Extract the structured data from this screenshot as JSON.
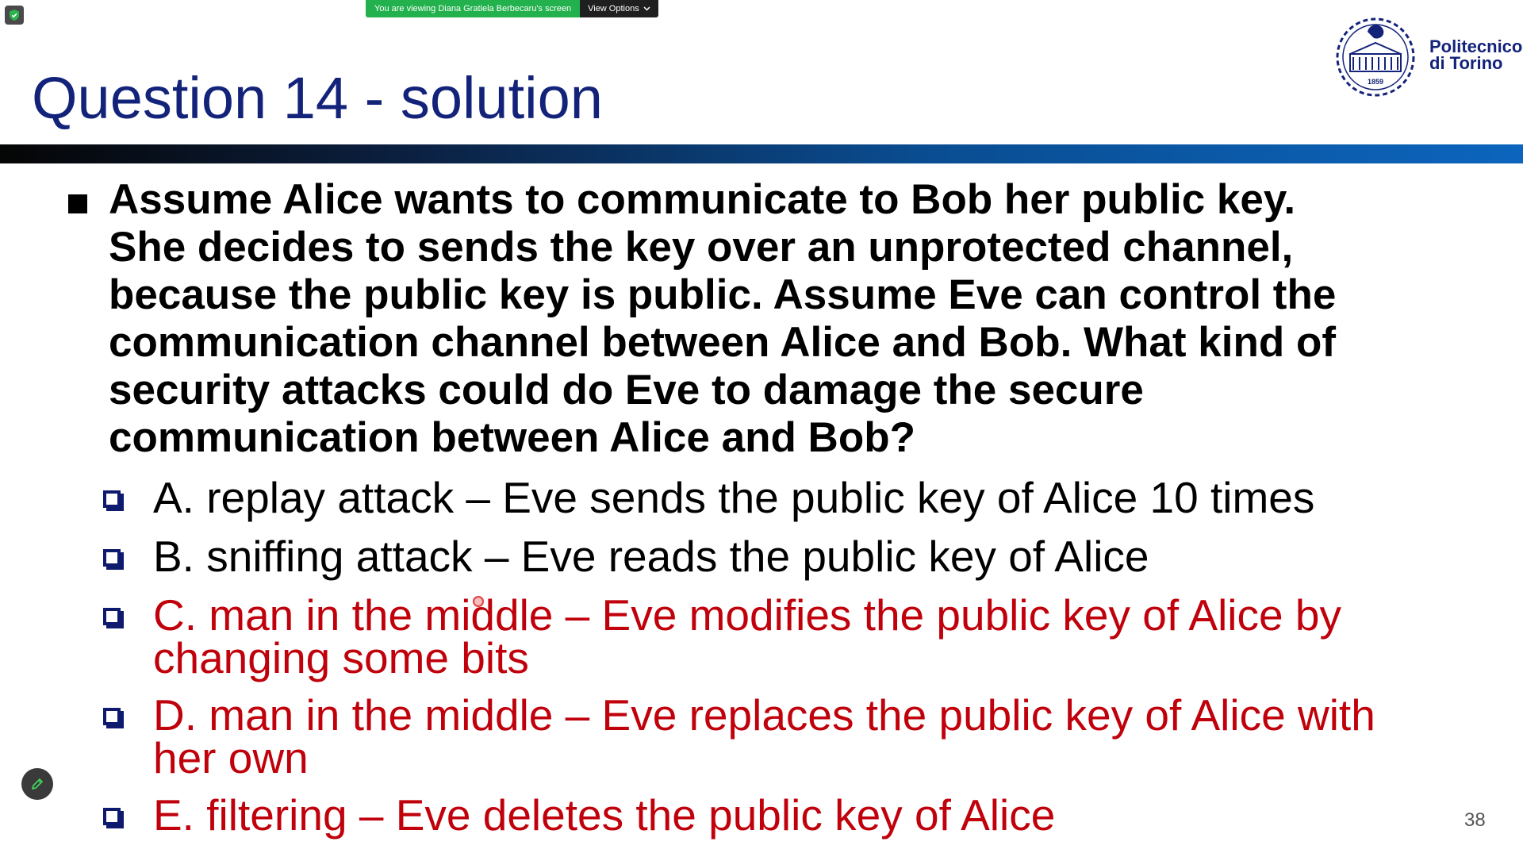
{
  "zoom": {
    "share_banner_text": "You are viewing Diana Gratiela Berbecaru's screen",
    "view_options_label": "View Options",
    "security_icon": "shield-check-icon",
    "annotate_icon": "pencil-icon"
  },
  "slide": {
    "title": "Question 14 - solution",
    "logo": {
      "line1": "Politecnico",
      "line2": "di Torino",
      "year": "1859"
    },
    "question_lines": [
      "Assume Alice wants to communicate to Bob her public key.",
      "She decides to sends the key over an unprotected channel,",
      "because the public key is public. Assume Eve can control the",
      "communication channel between Alice and Bob.  What kind of",
      "security attacks could do Eve to damage the secure",
      "communication between Alice and Bob?"
    ],
    "options": [
      {
        "lines": [
          "A. replay attack – Eve sends the public key of Alice 10 times"
        ],
        "correct": false
      },
      {
        "lines": [
          "B. sniffing attack – Eve reads the public key of Alice"
        ],
        "correct": false
      },
      {
        "lines": [
          "C. man in the middle – Eve modifies the public key of Alice by",
          "changing some bits"
        ],
        "correct": true
      },
      {
        "lines": [
          "D. man in the middle – Eve replaces the public key of Alice with",
          "her own"
        ],
        "correct": true
      },
      {
        "lines": [
          "E. filtering – Eve deletes the public key of Alice"
        ],
        "correct": true
      }
    ],
    "page_number": "38"
  },
  "colors": {
    "title": "#13237a",
    "correct_answer": "#c0000b",
    "share_banner": "#22b14c"
  }
}
